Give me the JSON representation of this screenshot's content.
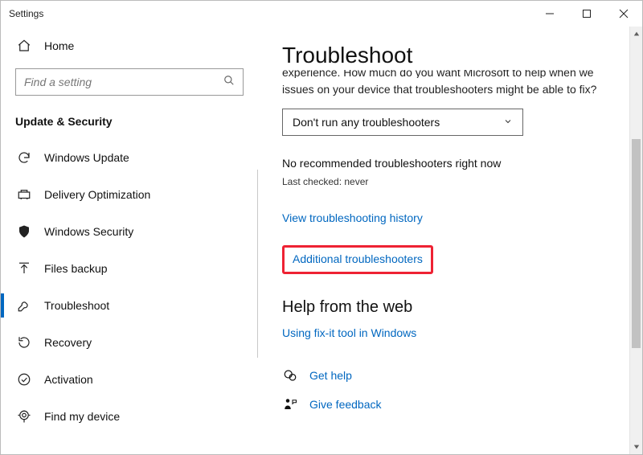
{
  "window": {
    "title": "Settings"
  },
  "sidebar": {
    "home_label": "Home",
    "search_placeholder": "Find a setting",
    "section_label": "Update & Security",
    "items": [
      {
        "label": "Windows Update"
      },
      {
        "label": "Delivery Optimization"
      },
      {
        "label": "Windows Security"
      },
      {
        "label": "Files backup"
      },
      {
        "label": "Troubleshoot"
      },
      {
        "label": "Recovery"
      },
      {
        "label": "Activation"
      },
      {
        "label": "Find my device"
      }
    ]
  },
  "main": {
    "page_title": "Troubleshoot",
    "truncated_prefix_line": "experience. How much do you want Microsoft to help when we find",
    "truncated_line2": "issues on your device that troubleshooters might be able to fix?",
    "dropdown_value": "Don't run any troubleshooters",
    "no_recommended": "No recommended troubleshooters right now",
    "last_checked": "Last checked: never",
    "view_history": "View troubleshooting history",
    "additional": "Additional troubleshooters",
    "help_heading": "Help from the web",
    "fixit_link": "Using fix-it tool in Windows",
    "get_help": "Get help",
    "give_feedback": "Give feedback"
  }
}
